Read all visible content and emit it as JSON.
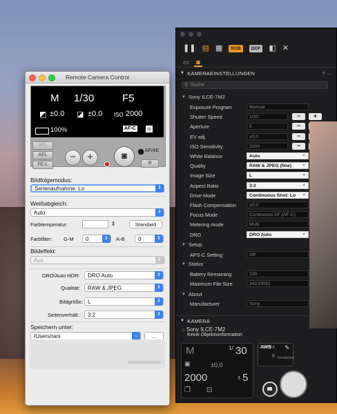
{
  "wallpaper": {
    "sky_color": "#8a9ac0",
    "rock_color": "#4a3734"
  },
  "remote_window": {
    "title": "Remote Camera Control",
    "lcd": {
      "mode": "M",
      "shutter": "1/30",
      "aperture": "F5",
      "ev_icon": "ev-icon",
      "ev_value": "±0.0",
      "flash_icon": "flash-comp-icon",
      "flash_value": "±0.0",
      "iso_label": "ISO",
      "iso_value": "2000",
      "battery": "100%",
      "focus_mode": "AF-C",
      "metering_icon": "metering-icon"
    },
    "controls": {
      "afl": "AFL",
      "ael": "AEL",
      "fel": "FE-L",
      "minus": "−",
      "plus": "+",
      "afae": "AF/AE"
    },
    "form": {
      "drive_label": "Bildfolgemodus:",
      "drive_value": "Serienaufnahme: Lo",
      "wb_label": "Weißabgleich:",
      "wb_value": "Auto",
      "colortemp_label": "Farbtemperatur:",
      "standard_button": "Standard",
      "colorfilter_label": "Farbfilter:",
      "gm_label": "G-M",
      "gm_value": "0",
      "ab_label": "A-B",
      "ab_value": "0",
      "effect_label": "Bildeffekt:",
      "effect_value": "Aus",
      "dro_label": "DRO/Auto HDR:",
      "dro_value": "DRO Auto",
      "quality_label": "Qualität:",
      "quality_value": "RAW & JPEG",
      "size_label": "Bildgröße:",
      "size_value": "L",
      "aspect_label": "Seitenverhält.:",
      "aspect_value": "3:2",
      "save_label": "Speichern unter:",
      "save_value": "/Users/rani",
      "browse_button": "..."
    }
  },
  "dark_panel": {
    "toolbar": {
      "pause_icon": "pause-icon",
      "film_icon": "film-strip-icon",
      "grid_icon": "grid-icon",
      "rgb": "RGB",
      "dof": "DOF",
      "exposure_icon": "exposure-icon",
      "tools_icon": "tools-icon"
    },
    "section_title": "KAMERAEINSTELLUNGEN",
    "search_placeholder": "Suche",
    "camera_group": "Sony ILCE-7M2",
    "settings": [
      {
        "label": "Exposure Program",
        "value": "Manual"
      },
      {
        "label": "Shutter Speed",
        "value": "1/30"
      },
      {
        "label": "Aperture",
        "value": "5"
      },
      {
        "label": "EV adj.",
        "value": "±0.0"
      },
      {
        "label": "ISO Sensitivity",
        "value": "2000"
      },
      {
        "label": "White Balance",
        "value": "Auto"
      },
      {
        "label": "Quality",
        "value": "RAW & JPEG (fine)"
      },
      {
        "label": "Image Size",
        "value": "L"
      },
      {
        "label": "Aspect Ratio",
        "value": "3:2"
      },
      {
        "label": "Drive Mode",
        "value": "Continuous Shot: Lo"
      },
      {
        "label": "Flash Compensation",
        "value": "±0.0"
      },
      {
        "label": "Focus Mode",
        "value": "Continuous AF (AF-C)"
      },
      {
        "label": "Metering mode",
        "value": "Multi"
      },
      {
        "label": "DRO",
        "value": "DRO Auto"
      }
    ],
    "setup_group": "Setup",
    "setup_items": [
      {
        "label": "APS-C Setting",
        "value": "Off"
      }
    ],
    "status_group": "Status",
    "status_items": [
      {
        "label": "Battery Remaining",
        "value": "100"
      },
      {
        "label": "Maximum File Size",
        "value": "34220032"
      }
    ],
    "about_group": "About",
    "about_items": [
      {
        "label": "Manufacturer",
        "value": "Sony"
      }
    ],
    "kamera_title": "KAMERA",
    "kamera_model": "Sony ILCE-7M2",
    "kamera_lens": "Keine Objektivinformation",
    "kamera_display": {
      "mode": "M",
      "shutter_num": "1/",
      "shutter_den": "30",
      "ev": "±0.0",
      "iso": "2000",
      "aperture_prefix": "f",
      "aperture": "5"
    },
    "wb_box": {
      "awb": "AWB",
      "a": "A",
      "r": "R",
      "einstellen": "Einstellen"
    },
    "help": "?",
    "more": "···"
  }
}
